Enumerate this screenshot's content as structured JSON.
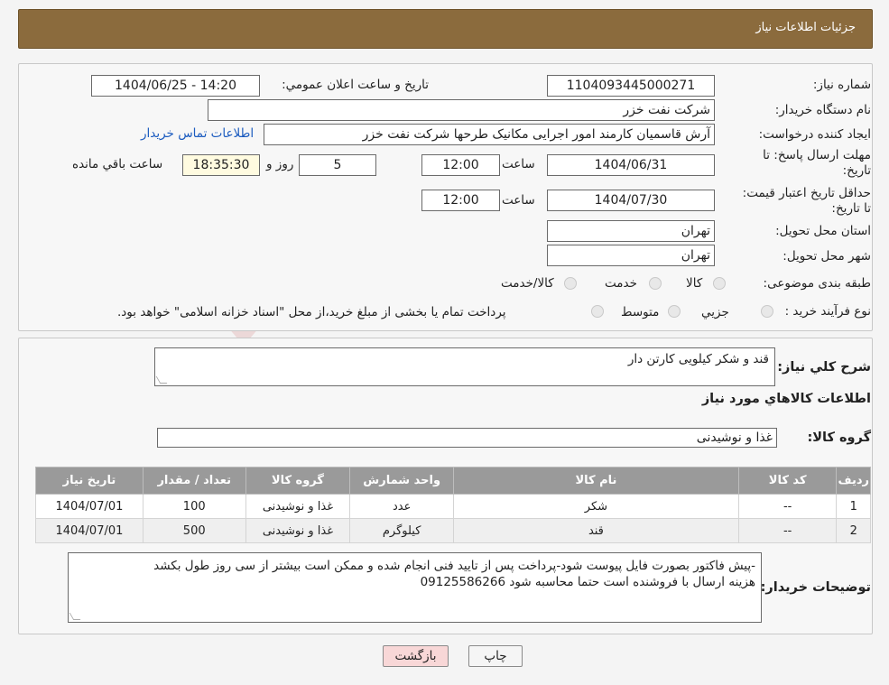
{
  "header": {
    "title": "جزئیات اطلاعات نیاز"
  },
  "form": {
    "need_number_label": "شماره نیاز:",
    "need_number": "1104093445000271",
    "announce_label": "تاریخ و ساعت اعلان عمومي:",
    "announce_value": "1404/06/25 - 14:20",
    "buyer_org_label": "نام دستگاه خریدار:",
    "buyer_org": "شرکت نفت خزر",
    "creator_label": "ایجاد کننده درخواست:",
    "creator": "آرش قاسمیان کارمند امور اجرایی مکانیک طرحها شرکت نفت خزر",
    "contact_link": "اطلاعات تماس خریدار",
    "deadline_label": "مهلت ارسال پاسخ: تا تاریخ:",
    "deadline_date": "1404/06/31",
    "time_label": "ساعت",
    "deadline_time": "12:00",
    "days_value": "5",
    "days_label": "روز و",
    "remaining_value": "18:35:30",
    "remaining_label": "ساعت باقي مانده",
    "validity_label": "حداقل تاریخ اعتبار قیمت: تا تاریخ:",
    "validity_date": "1404/07/30",
    "validity_time": "12:00",
    "province_label": "استان محل تحویل:",
    "province": "تهران",
    "city_label": "شهر محل تحویل:",
    "city": "تهران",
    "category_label": "طبقه بندی موضوعی:",
    "category_options": [
      "کالا",
      "خدمت",
      "کالا/خدمت"
    ],
    "process_label": "نوع فرآیند خرید :",
    "process_options": [
      "جزیي",
      "متوسط"
    ],
    "process_note": "پرداخت تمام یا بخشی از مبلغ خرید،از محل \"اسناد خزانه اسلامی\" خواهد بود."
  },
  "details": {
    "summary_label": "شرح کلي نیاز:",
    "summary": "قند و شکر کیلویی کارتن دار",
    "goods_info_title": "اطلاعات کالاهاي مورد نیاز",
    "goods_group_label": "گروه کالا:",
    "goods_group": "غذا و نوشیدنی",
    "table": {
      "headers": [
        "ردیف",
        "کد کالا",
        "نام کالا",
        "واحد شمارش",
        "گروه کالا",
        "تعداد / مقدار",
        "تاریخ نیاز"
      ],
      "rows": [
        [
          "1",
          "--",
          "شکر",
          "عدد",
          "غذا و نوشیدنی",
          "100",
          "1404/07/01"
        ],
        [
          "2",
          "--",
          "قند",
          "کیلوگرم",
          "غذا و نوشیدنی",
          "500",
          "1404/07/01"
        ]
      ]
    },
    "buyer_notes_label": "توضیحات خریدار:",
    "buyer_notes_line1": "-پیش فاکتور بصورت فایل پیوست شود-پرداخت پس از تایید فنی انجام شده و ممکن است بیشتر از سی روز طول بکشد",
    "buyer_notes_line2": "هزینه ارسال با فروشنده است حتما محاسبه شود 09125586266"
  },
  "buttons": {
    "print": "چاپ",
    "back": "بازگشت"
  },
  "colors": {
    "header_bg": "#8b6b3d",
    "table_header_bg": "#9a9a9a",
    "link": "#1b5bbf",
    "back_btn_bg": "#f8d7d7"
  }
}
